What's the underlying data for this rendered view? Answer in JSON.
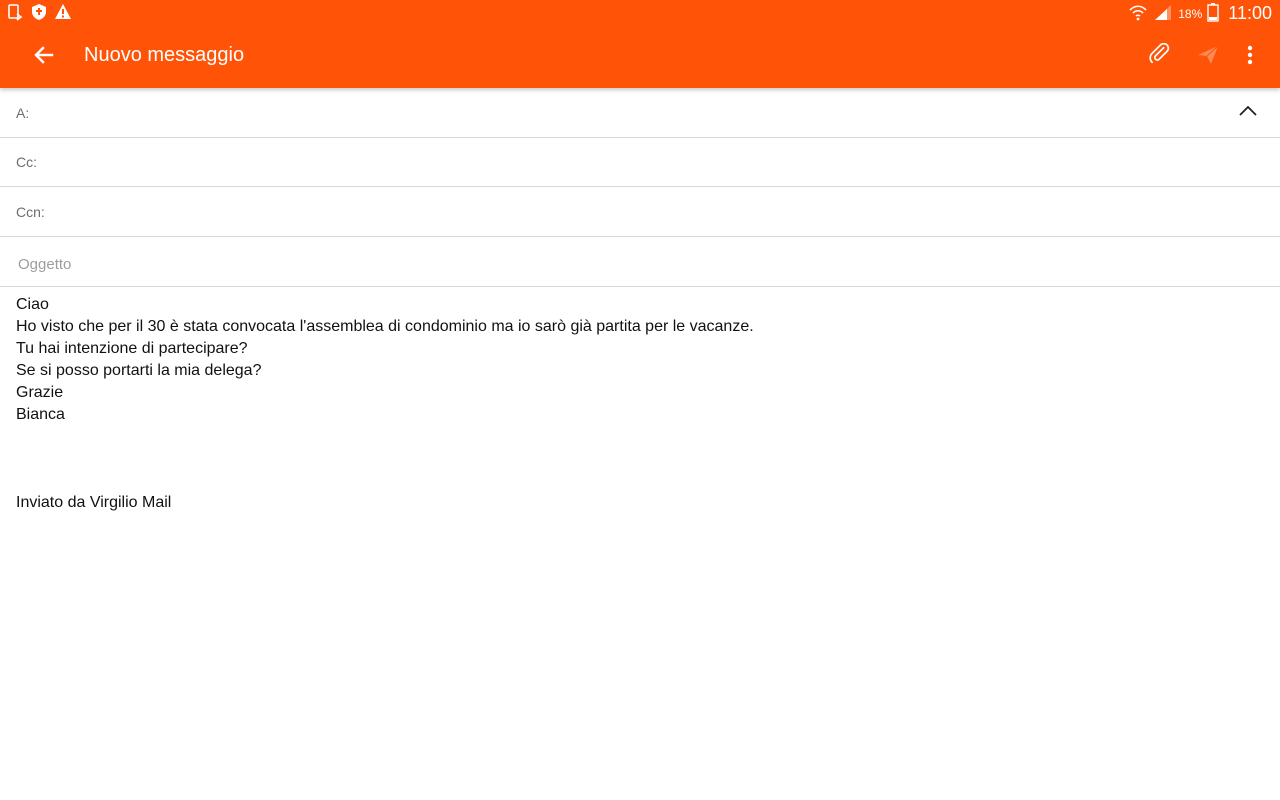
{
  "status_bar": {
    "battery_percent": "18%",
    "time": "11:00",
    "icons": [
      "tablet-sync-icon",
      "shield-icon",
      "warning-icon",
      "wifi-icon",
      "signal-icon",
      "battery-icon"
    ]
  },
  "toolbar": {
    "title": "Nuovo messaggio",
    "icons": [
      "back-arrow-icon",
      "paperclip-icon",
      "send-icon",
      "more-vert-icon"
    ],
    "accent_color": "#ff5307",
    "send_disabled_color": "#ff8a55"
  },
  "fields": {
    "to_label": "A:",
    "cc_label": "Cc:",
    "bcc_label": "Ccn:",
    "subject_placeholder": "Oggetto"
  },
  "body": {
    "lines": [
      "Ciao",
      "Ho visto che per il 30 è stata convocata l'assemblea di condominio ma io sarò già partita per le vacanze.",
      "Tu hai intenzione di partecipare?",
      "Se si posso portarti la mia delega?",
      "Grazie",
      "Bianca",
      "",
      "",
      "",
      "Inviato da Virgilio Mail"
    ]
  }
}
